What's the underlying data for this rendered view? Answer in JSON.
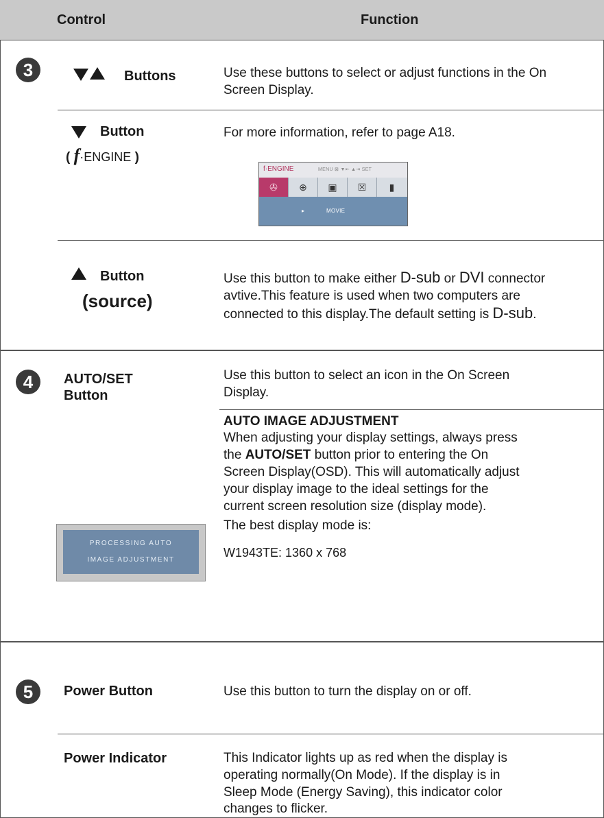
{
  "header": {
    "control_label": "Control",
    "function_label": "Function"
  },
  "section3": {
    "number": "3",
    "buttons_label": "Buttons",
    "buttons_desc_1": "Use these buttons to select or adjust functions in the On",
    "buttons_desc_2": "Screen Display.",
    "down_label": "Button",
    "fengine_open": "(",
    "fengine_f": "f",
    "fengine_text": "·ENGINE",
    "fengine_close": ")",
    "down_desc": "For more information, refer to page A18.",
    "osd": {
      "title": "f·ENGINE",
      "menu_hint": "MENU ⊠ ▼⇤ ▲⇥ SET",
      "icons": [
        "movie-reel-icon",
        "globe-icon",
        "picture-icon",
        "close-box-icon",
        "film-icon"
      ],
      "arrow": "▸",
      "mode": "MOVIE"
    },
    "up_label": "Button",
    "up_sub": "(source)",
    "up_desc_1a": "Use this button to make either ",
    "up_desc_1b": "D-sub",
    "up_desc_1c": " or ",
    "up_desc_1d": "DVI",
    "up_desc_1e": " connector",
    "up_desc_2": "avtive.This feature is used when two computers are",
    "up_desc_3a": "connected to this display.The default setting is ",
    "up_desc_3b": "D-sub",
    "up_desc_3c": "."
  },
  "section4": {
    "number": "4",
    "label_1": "AUTO/SET",
    "label_2": "Button",
    "desc_1": "Use this button to select an icon in the On Screen",
    "desc_2": "Display.",
    "auto_title": "AUTO IMAGE ADJUSTMENT",
    "auto_1": "When adjusting your display settings, always press",
    "auto_2a": "the ",
    "auto_2b": "AUTO/SET",
    "auto_2c": " button prior to entering the On",
    "auto_3": "Screen Display(OSD). This will automatically adjust",
    "auto_4": "your display image to the ideal settings for the",
    "auto_5": "current screen resolution size (display mode).",
    "best": "The best display mode is:",
    "mode": "W1943TE: 1360 x 768",
    "proc_1": "PROCESSING AUTO",
    "proc_2": "IMAGE ADJUSTMENT"
  },
  "section5": {
    "number": "5",
    "power_label": "Power Button",
    "power_desc": "Use this button to turn the display on or off.",
    "ind_label": "Power Indicator",
    "ind_1": "This Indicator lights up as red when the display is",
    "ind_2": "operating normally(On Mode). If the display is in",
    "ind_3": "Sleep Mode (Energy Saving), this indicator color",
    "ind_4": "changes to flicker."
  }
}
